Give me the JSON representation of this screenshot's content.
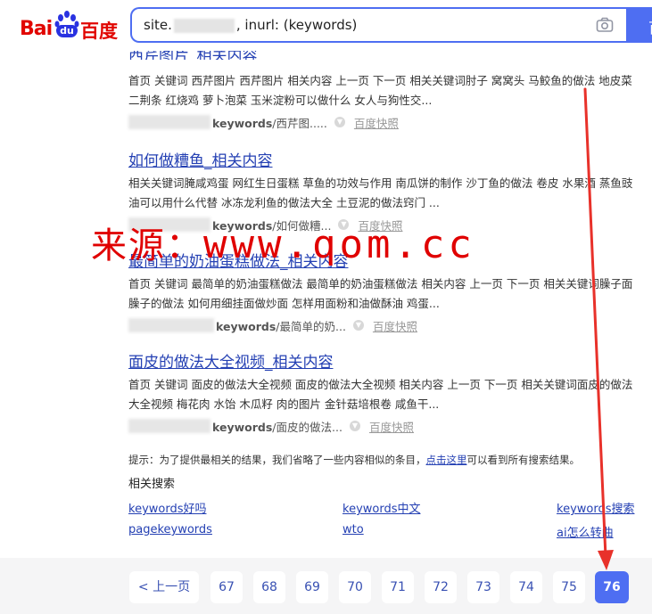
{
  "header": {
    "logo_text_latin": "Bai",
    "logo_text_du": "du",
    "logo_text_cn": "百度",
    "query_prefix": "site.",
    "query_suffix": ", inurl: (keywords)",
    "search_button_label": "百"
  },
  "cut_title": "西芹图片_相关内容",
  "results": [
    {
      "title": "",
      "abstract": "首页 关键词 西芹图片 西芹图片 相关内容 上一页 下一页 相关关键词肘子 窝窝头 马鲛鱼的做法 地皮菜 二荆条 红烧鸡 萝卜泡菜 玉米淀粉可以做什么 女人与狗性交...",
      "url_bold": "keywords",
      "url_rest": "/西芹图.....",
      "snapshot": "百度快照"
    },
    {
      "title": "如何做糟鱼_相关内容",
      "abstract": "相关关键词腌咸鸡蛋 网红生日蛋糕 草鱼的功效与作用 南瓜饼的制作 沙丁鱼的做法 卷皮 水果酒 蒸鱼豉油可以用什么代替 冰冻龙利鱼的做法大全 土豆泥的做法窍门 ...",
      "url_bold": "keywords",
      "url_rest": "/如何做糟...",
      "snapshot": "百度快照"
    },
    {
      "title": "最简单的奶油蛋糕做法_相关内容",
      "abstract": "首页 关键词 最简单的奶油蛋糕做法 最简单的奶油蛋糕做法 相关内容 上一页 下一页 相关关键词臊子面臊子的做法 如何用细挂面做炒面 怎样用面粉和油做酥油 鸡蛋...",
      "url_bold": "keywords",
      "url_rest": "/最简单的奶...",
      "snapshot": "百度快照"
    },
    {
      "title": "面皮的做法大全视频_相关内容",
      "abstract": "首页 关键词 面皮的做法大全视频 面皮的做法大全视频 相关内容 上一页 下一页 相关关键词面皮的做法大全视频 梅花肉 水饴 木瓜籽 肉的图片 金针菇培根卷 咸鱼干...",
      "url_bold": "keywords",
      "url_rest": "/面皮的做法...",
      "snapshot": "百度快照"
    }
  ],
  "tip": {
    "before": "提示：为了提供最相关的结果，我们省略了一些内容相似的条目，",
    "link": "点击这里",
    "after": "可以看到所有搜索结果。"
  },
  "related": {
    "title": "相关搜索",
    "items": [
      "keywords好吗",
      "keywords中文",
      "keywords搜索",
      "pagekeywords",
      "wto",
      "ai怎么转曲"
    ]
  },
  "pager": {
    "prev": "< 上一页",
    "pages": [
      "67",
      "68",
      "69",
      "70",
      "71",
      "72",
      "73",
      "74",
      "75",
      "76"
    ],
    "current": "76"
  },
  "watermark": {
    "cn": "来源：",
    "latin": "www.qom.cc"
  },
  "colors": {
    "link": "#2440b3",
    "brand_blue": "#4e6ef2",
    "brand_red": "#e10601",
    "watermark": "#e00000"
  }
}
